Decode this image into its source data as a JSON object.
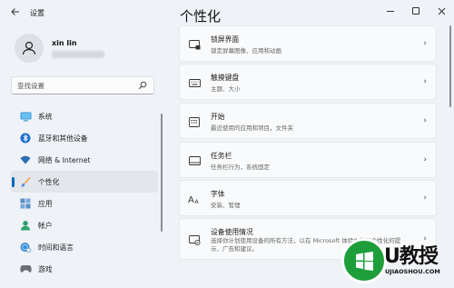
{
  "window": {
    "title": "设置"
  },
  "user": {
    "name": "xin lin"
  },
  "search": {
    "placeholder": "查找设置"
  },
  "sidebar": {
    "items": [
      {
        "label": "系统",
        "icon": "monitor-icon"
      },
      {
        "label": "蓝牙和其他设备",
        "icon": "bluetooth-icon"
      },
      {
        "label": "网络 & Internet",
        "icon": "wifi-icon"
      },
      {
        "label": "个性化",
        "icon": "brush-icon",
        "active": true
      },
      {
        "label": "应用",
        "icon": "apps-icon"
      },
      {
        "label": "帐户",
        "icon": "account-icon"
      },
      {
        "label": "时间和语言",
        "icon": "globe-clock-icon"
      },
      {
        "label": "游戏",
        "icon": "gamepad-icon"
      }
    ]
  },
  "main": {
    "title": "个性化",
    "cards": [
      {
        "title": "锁屏界面",
        "desc": "锁定屏幕图像、应用和动画",
        "icon": "lock-screen-icon"
      },
      {
        "title": "触摸键盘",
        "desc": "主题、大小",
        "icon": "keyboard-icon"
      },
      {
        "title": "开始",
        "desc": "最近使用的应用和项目，文件夹",
        "icon": "start-icon"
      },
      {
        "title": "任务栏",
        "desc": "任务栏行为，系统固定",
        "icon": "taskbar-icon"
      },
      {
        "title": "字体",
        "desc": "安装、管理",
        "icon": "font-icon"
      },
      {
        "title": "设备使用情况",
        "desc": "选择你计划使用设备的所有方法，以在 Microsoft 体验中获取个性化的提示、广告和建议。",
        "icon": "device-usage-icon"
      }
    ]
  },
  "watermark": {
    "title": "U教授",
    "url": "UJIAOSHOU.COM"
  },
  "colors": {
    "accent": "#0067c0",
    "watermark_green": "#1e9e3a"
  }
}
